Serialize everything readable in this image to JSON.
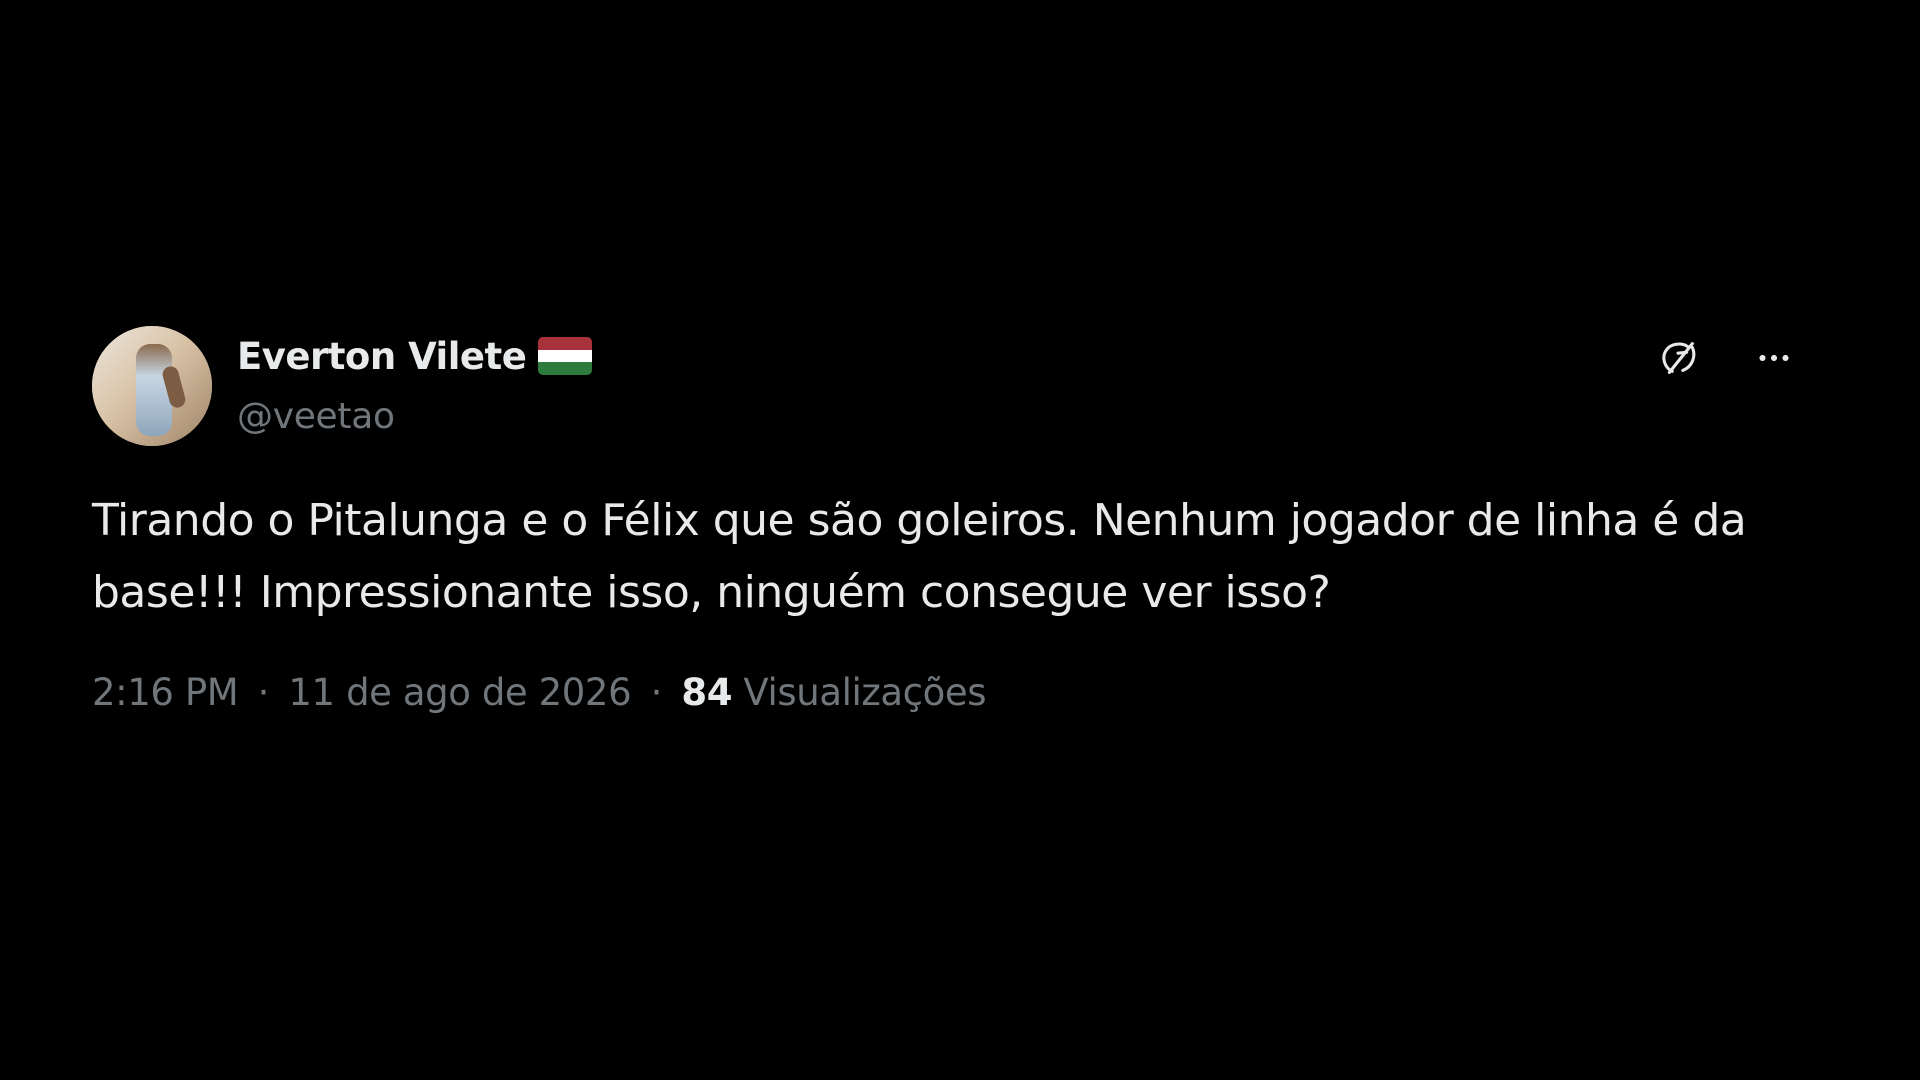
{
  "tweet": {
    "display_name": "Everton Vilete",
    "username": "@veetao",
    "text": "Tirando o Pitalunga e o Félix que são goleiros. Nenhum jogador de linha é da base!!! Impressionante isso, ninguém consegue ver isso?",
    "time": "2:16 PM",
    "date": "11 de ago de 2026",
    "separator": "·",
    "views_count": "84",
    "views_label": "Visualizações"
  },
  "icons": {
    "grok": "grok-icon",
    "more": "more-icon"
  },
  "colors": {
    "background": "#000000",
    "primary_text": "#e7e9ea",
    "secondary_text": "#71767b",
    "flag_red": "#a7323b",
    "flag_white": "#ffffff",
    "flag_green": "#2f7a3d"
  }
}
